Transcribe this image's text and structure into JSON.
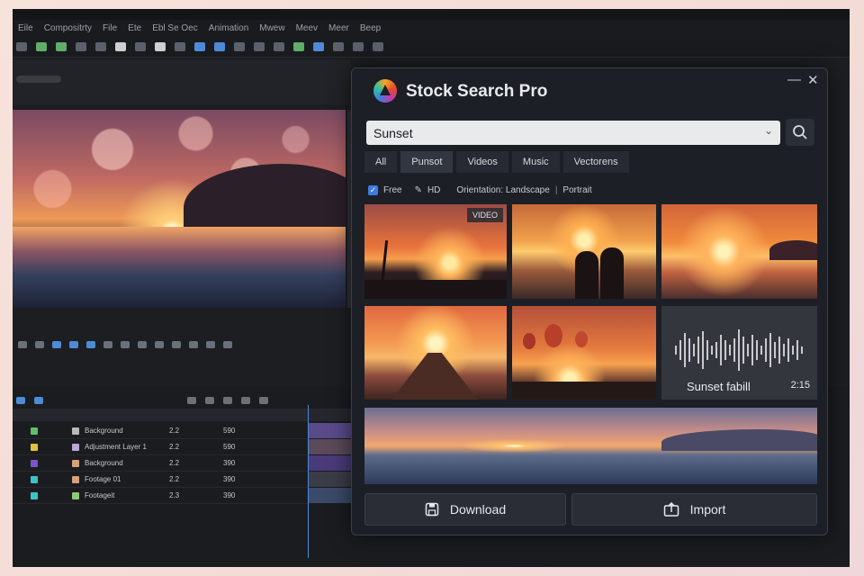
{
  "host_app": {
    "menu": [
      "Eile",
      "Compositrty",
      "File",
      "Ete",
      "Ebl Se Oec",
      "Animation",
      "Mwew",
      "Meev",
      "Meer",
      "Beep"
    ],
    "layers": [
      {
        "name": "Background",
        "c1": "2.2",
        "c2": "590",
        "color": "#5fbf6a",
        "label": "#b9b9b9"
      },
      {
        "name": "Adjustment Layer 1",
        "c1": "2.2",
        "c2": "590",
        "color": "#e0c23c",
        "label": "#b9a9d8"
      },
      {
        "name": "Background",
        "c1": "2.2",
        "c2": "390",
        "color": "#7a55c8",
        "label": "#d8a07a"
      },
      {
        "name": "Footage 01",
        "c1": "2.2",
        "c2": "390",
        "color": "#3cc3c8",
        "label": "#d8a07a"
      },
      {
        "name": "Footageit",
        "c1": "2.3",
        "c2": "390",
        "color": "#3cc3c8",
        "label": "#8cc87a"
      }
    ]
  },
  "dialog": {
    "title": "Stock Search Pro",
    "search_value": "Sunset",
    "tabs": [
      "All",
      "Punsot",
      "Videos",
      "Music",
      "Vectorens"
    ],
    "filters": {
      "free_label": "Free",
      "hd_label": "HD",
      "orientation_label": "Orientation: Landscape",
      "portrait_label": "Portrait"
    },
    "video_badge": "VIDEO",
    "audio": {
      "name": "Sunset fabill",
      "duration": "2:15"
    },
    "download_label": "Download",
    "import_label": "Import"
  }
}
